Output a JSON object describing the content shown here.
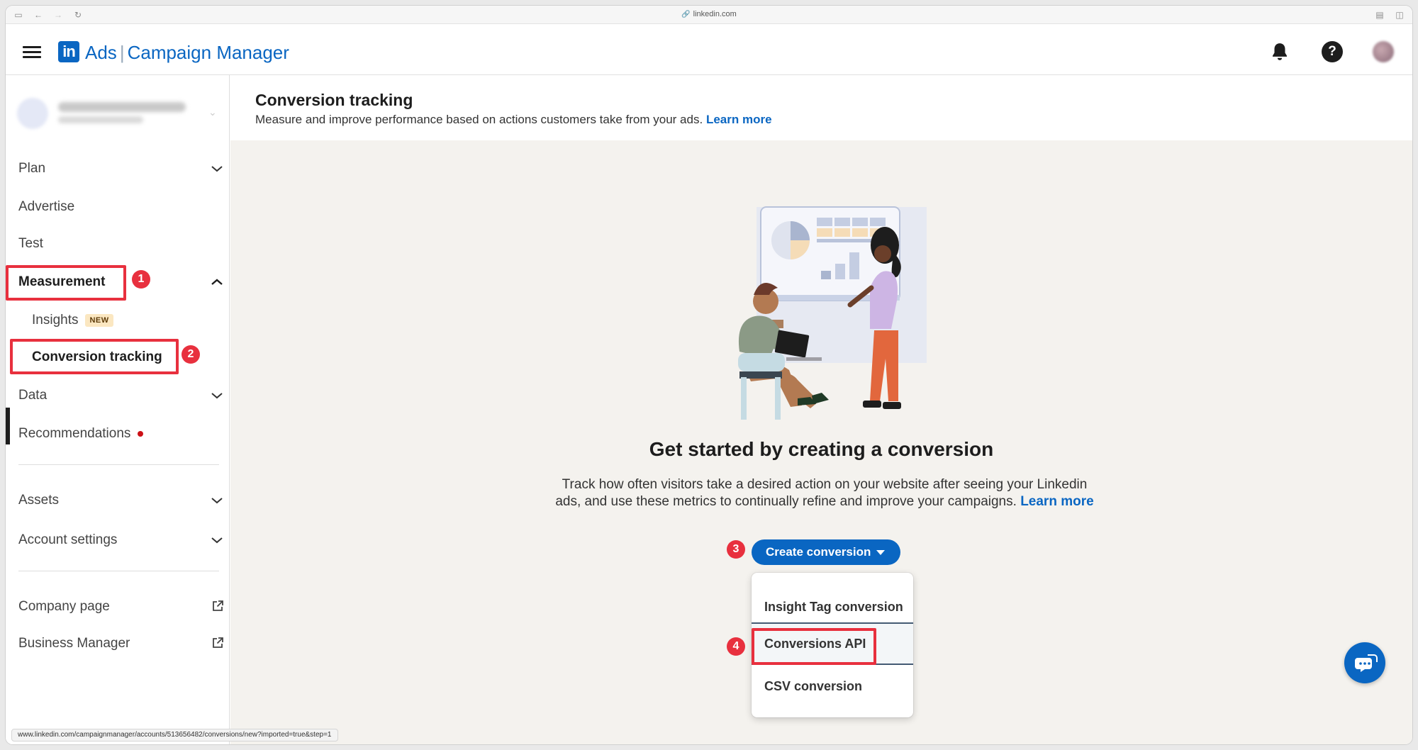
{
  "browser": {
    "url": "linkedin.com"
  },
  "header": {
    "brand_ads": "Ads",
    "brand_product": "Campaign Manager",
    "logo_text": "in"
  },
  "sidebar": {
    "items": [
      {
        "label": "Plan"
      },
      {
        "label": "Advertise"
      },
      {
        "label": "Test"
      },
      {
        "label": "Measurement"
      },
      {
        "label": "Insights",
        "badge": "NEW"
      },
      {
        "label": "Conversion tracking"
      },
      {
        "label": "Data"
      },
      {
        "label": "Recommendations"
      },
      {
        "label": "Assets"
      },
      {
        "label": "Account settings"
      },
      {
        "label": "Company page"
      },
      {
        "label": "Business Manager"
      }
    ]
  },
  "page": {
    "title": "Conversion tracking",
    "subtitle": "Measure and improve performance based on actions customers take from your ads.",
    "learn_more": "Learn more"
  },
  "empty_state": {
    "title": "Get started by creating a conversion",
    "description": "Track how often visitors take a desired action on your website after seeing your Linkedin ads, and use these metrics to continually refine and improve your campaigns.",
    "learn_more": "Learn more"
  },
  "cta": {
    "label": "Create conversion"
  },
  "dropdown": {
    "items": [
      {
        "label": "Insight Tag conversion"
      },
      {
        "label": "Conversions API"
      },
      {
        "label": "CSV conversion"
      }
    ]
  },
  "annotations": {
    "steps": [
      "1",
      "2",
      "3",
      "4"
    ]
  },
  "statusbar": {
    "text": "www.linkedin.com/campaignmanager/accounts/513656482/conversions/new?imported=true&step=1"
  },
  "colors": {
    "brand_blue": "#0a66c2",
    "highlight_red": "#e8303e",
    "main_bg": "#f4f2ee"
  }
}
